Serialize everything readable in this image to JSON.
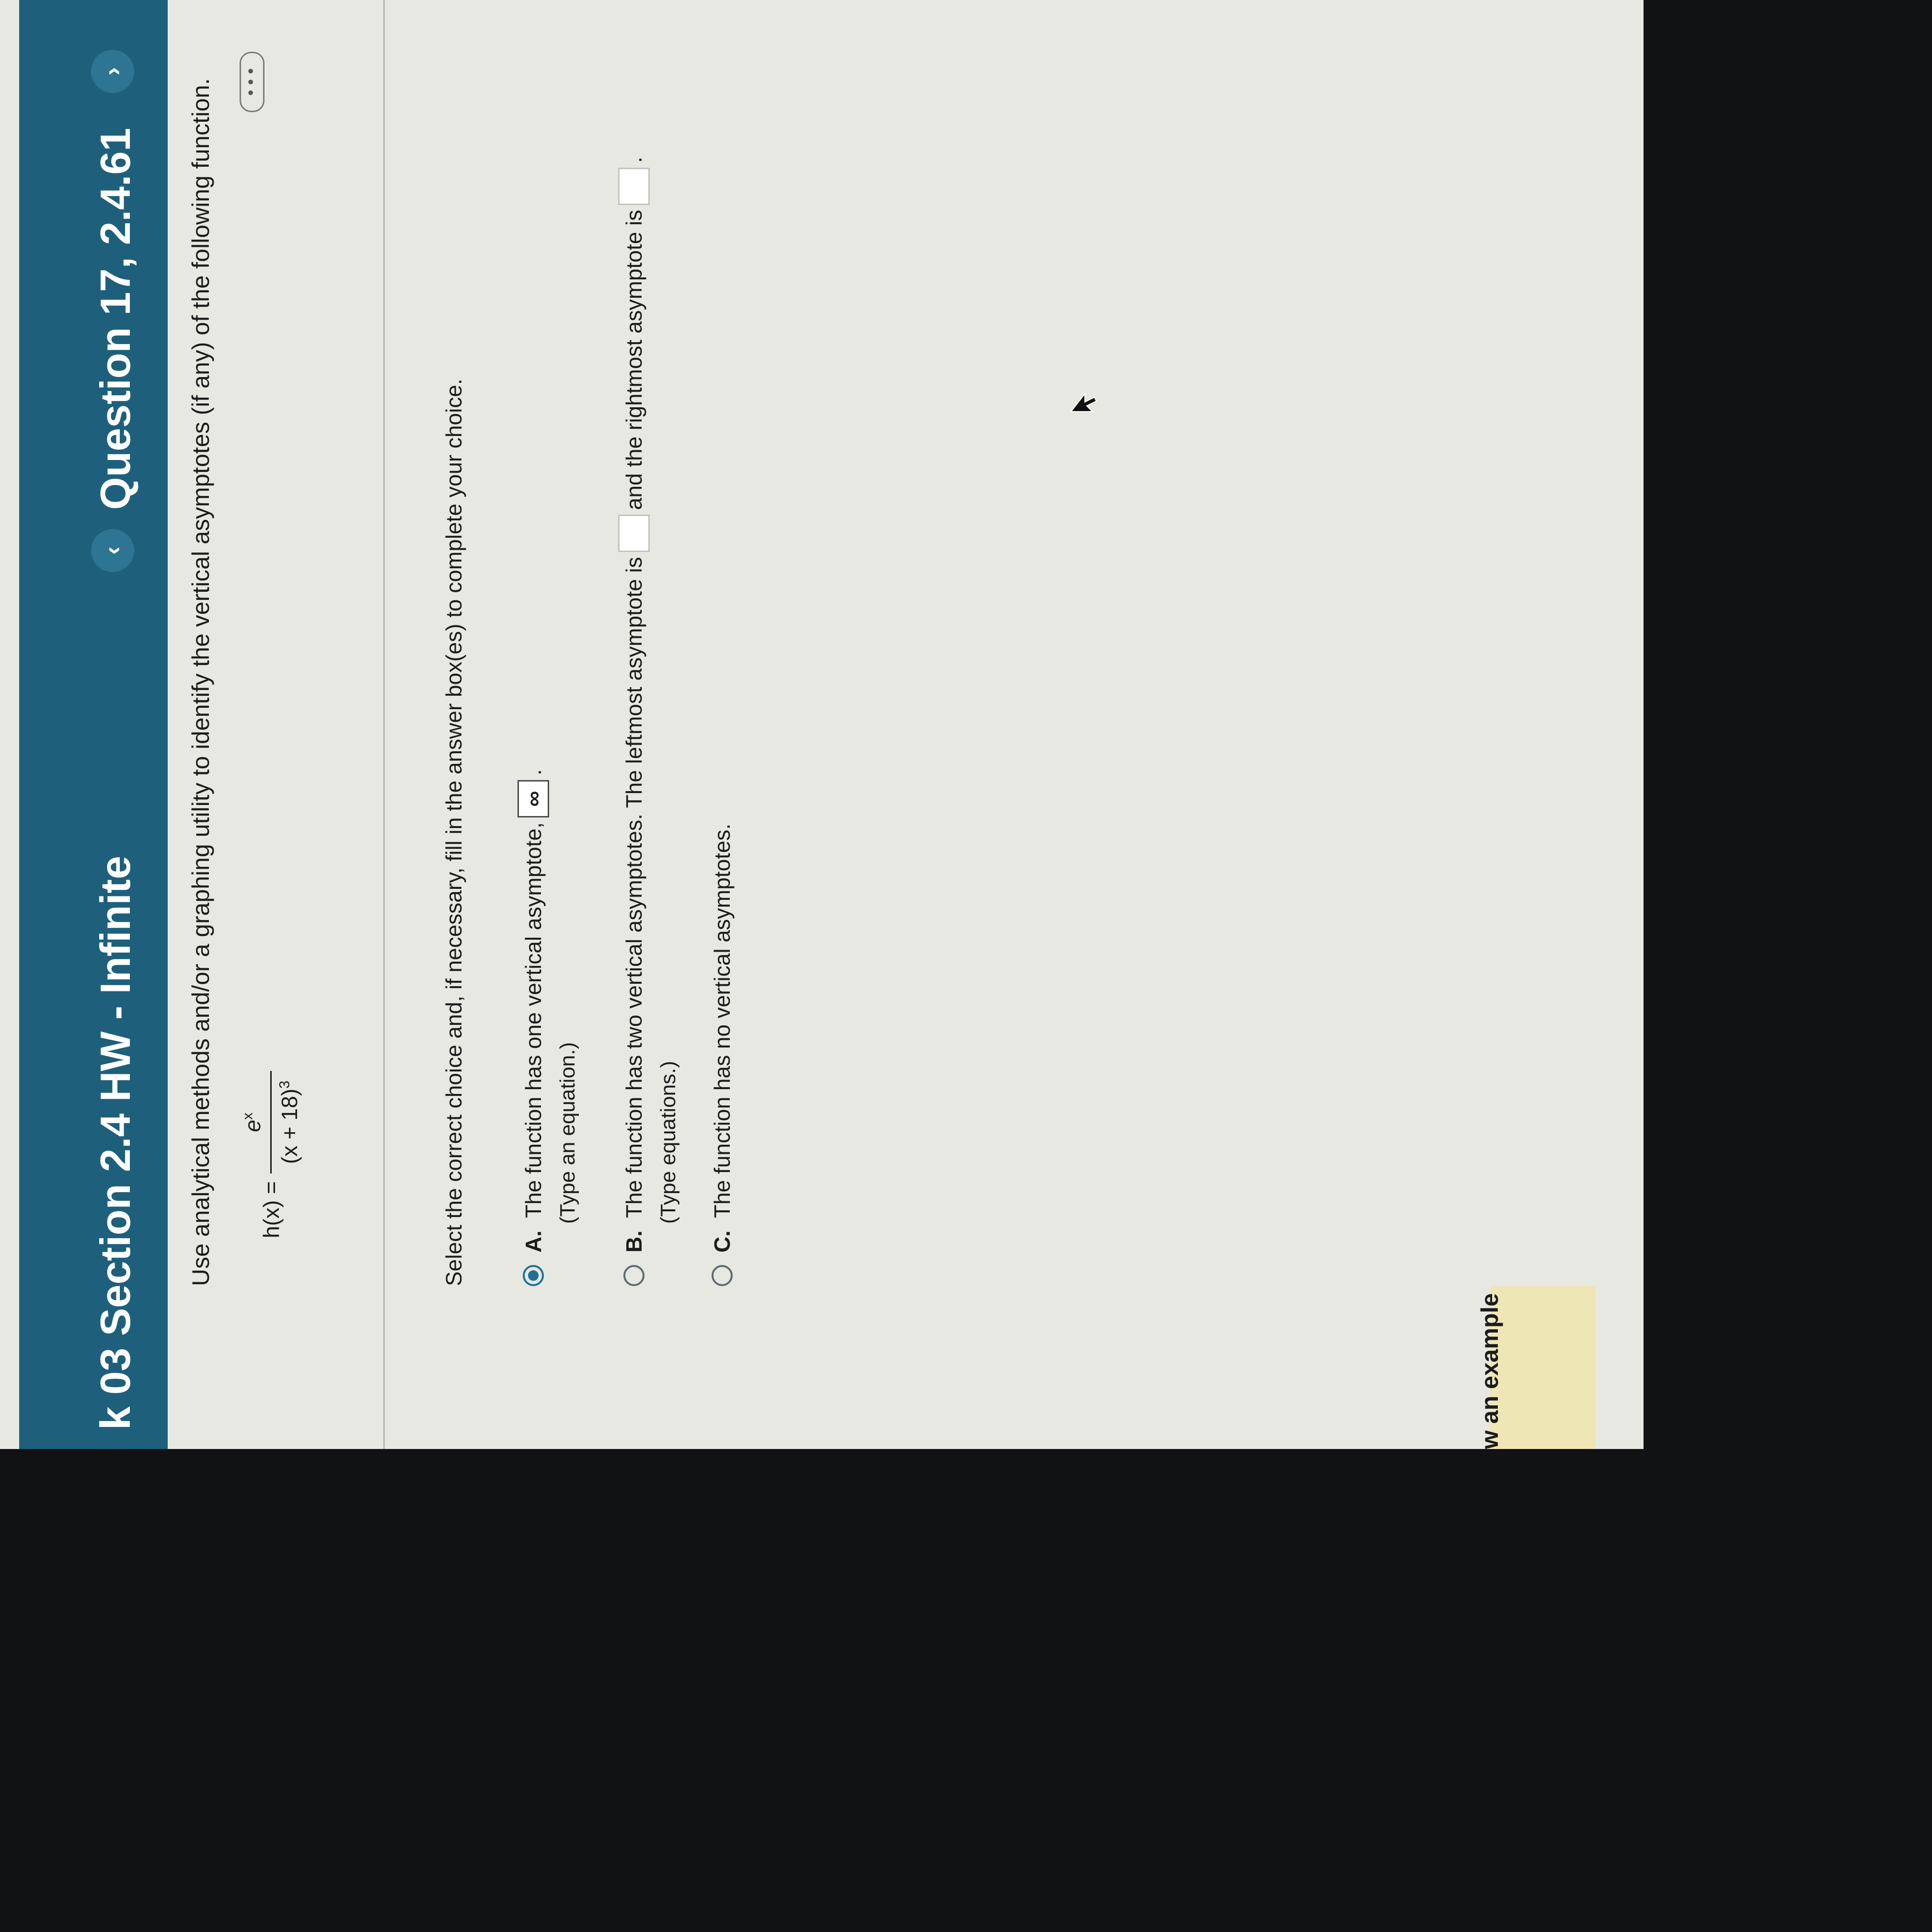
{
  "header": {
    "title": "k 03 Section 2.4 HW - Infinite",
    "question_label": "Question 17, 2.4.61",
    "prev_icon": "chevron-left-icon",
    "next_icon": "chevron-right-icon",
    "more_label": "• • •"
  },
  "question": {
    "instruction": "Use analytical methods and/or a graphing utility to identify the vertical asymptotes (if any) of the following function.",
    "function_lhs": "h(x) =",
    "numerator": "e",
    "numerator_sup": "x",
    "denominator": "(x + 18)",
    "denominator_sup": "3"
  },
  "answer": {
    "prompt": "Select the correct choice and, if necessary, fill in the answer box(es) to complete your choice.",
    "choices": [
      {
        "letter": "A.",
        "text_before": "The function has one vertical asymptote,",
        "box_value": "∞",
        "text_after": ".",
        "hint": "(Type an equation.)",
        "selected": true
      },
      {
        "letter": "B.",
        "text_before": "The function has two vertical asymptotes. The leftmost asymptote is",
        "text_middle": "and the rightmost asymptote is",
        "text_after": ".",
        "hint": "(Type equations.)",
        "selected": false
      },
      {
        "letter": "C.",
        "text": "The function has no vertical asymptotes.",
        "selected": false
      }
    ]
  },
  "footer": {
    "example_link": "w an example"
  },
  "colors": {
    "header_bg": "#1e607c",
    "page_bg": "#e7e8e2",
    "radio_selected": "#1e6f96"
  }
}
